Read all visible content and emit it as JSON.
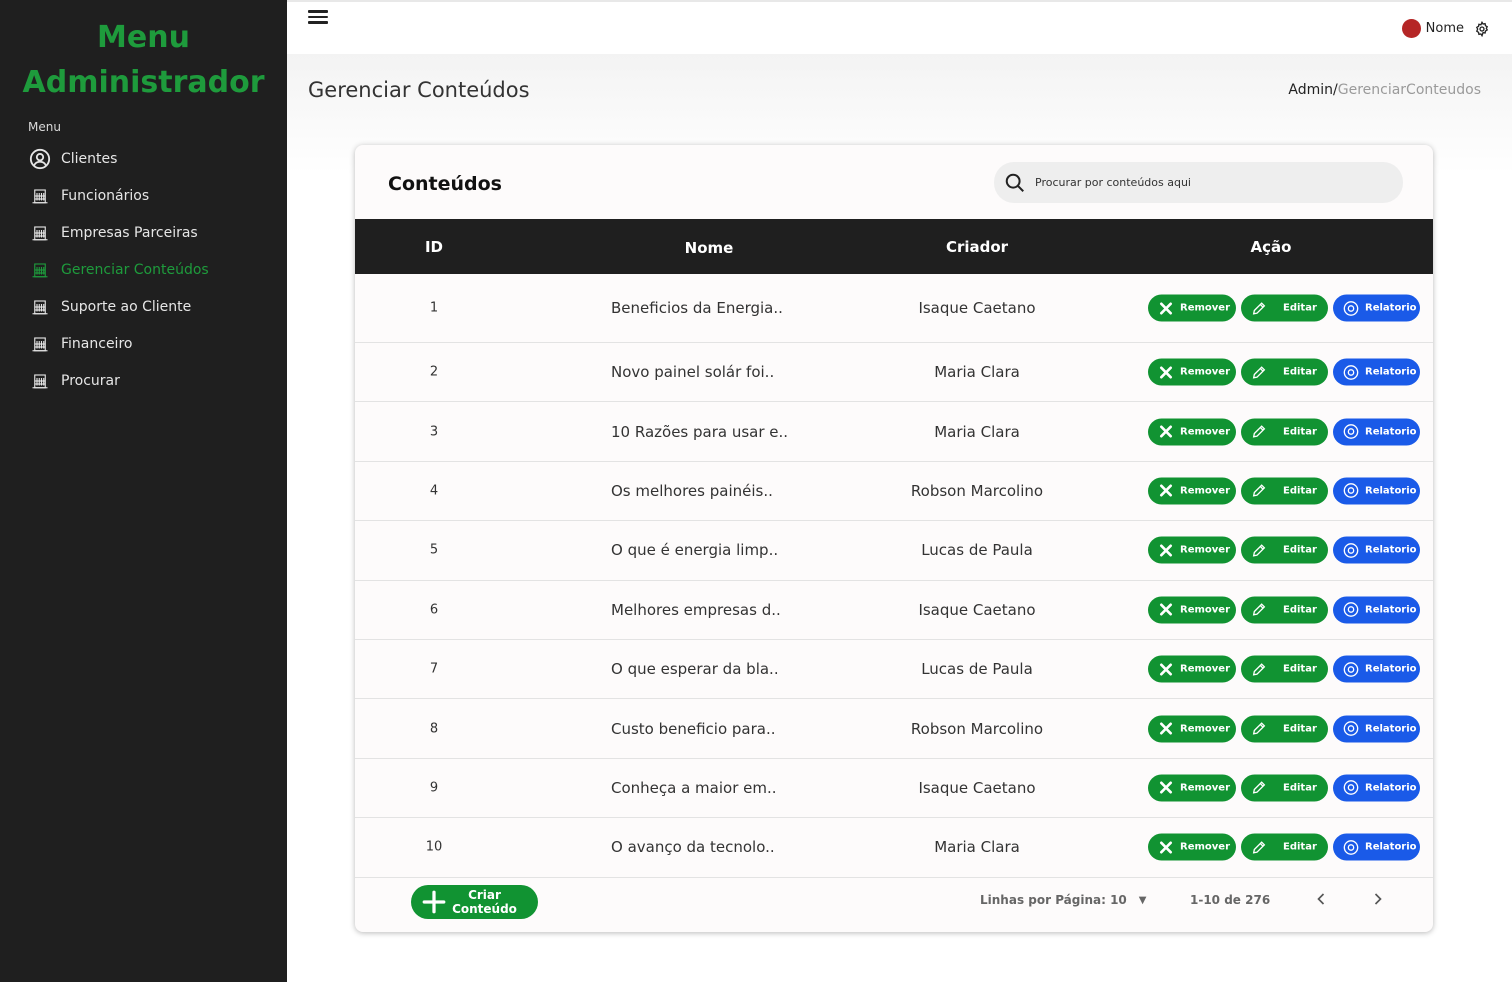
{
  "sidebar": {
    "brand_line1": "Menu",
    "brand_line2": "Administrador",
    "menu_label": "Menu",
    "items": [
      {
        "label": "Clientes",
        "icon": "user-circle-icon"
      },
      {
        "label": "Funcionários",
        "icon": "building-icon"
      },
      {
        "label": "Empresas Parceiras",
        "icon": "building-icon"
      },
      {
        "label": "Gerenciar Conteúdos",
        "icon": "building-icon",
        "active": true
      },
      {
        "label": "Suporte ao Cliente",
        "icon": "building-icon"
      },
      {
        "label": "Financeiro",
        "icon": "building-icon"
      },
      {
        "label": "Procurar",
        "icon": "building-icon"
      }
    ]
  },
  "topbar": {
    "user_name": "Nome"
  },
  "page": {
    "title": "Gerenciar Conteúdos",
    "breadcrumb_root": "Admin",
    "breadcrumb_sep": "/",
    "breadcrumb_current": "GerenciarConteudos"
  },
  "card": {
    "title": "Conteúdos",
    "search_placeholder": "Procurar por conteúdos aqui",
    "columns": {
      "id": "ID",
      "name": "Nome",
      "creator": "Criador",
      "action": "Ação"
    },
    "action_labels": {
      "remove": "Remover",
      "edit": "Editar",
      "report": "Relatorio"
    },
    "rows": [
      {
        "id": "1",
        "name": "Beneficios da Energia..",
        "creator": "Isaque Caetano"
      },
      {
        "id": "2",
        "name": "Novo painel solár foi..",
        "creator": "Maria Clara"
      },
      {
        "id": "3",
        "name": "10 Razões para usar e..",
        "creator": "Maria Clara"
      },
      {
        "id": "4",
        "name": "Os melhores painéis..",
        "creator": "Robson Marcolino"
      },
      {
        "id": "5",
        "name": "O que é energia limp..",
        "creator": "Lucas de Paula"
      },
      {
        "id": "6",
        "name": "Melhores empresas d..",
        "creator": "Isaque Caetano"
      },
      {
        "id": "7",
        "name": "O que esperar da bla..",
        "creator": "Lucas de Paula"
      },
      {
        "id": "8",
        "name": "Custo beneficio para..",
        "creator": "Robson Marcolino"
      },
      {
        "id": "9",
        "name": "Conheça a maior em..",
        "creator": "Isaque Caetano"
      },
      {
        "id": "10",
        "name": "O avanço da tecnolo..",
        "creator": "Maria Clara"
      }
    ],
    "footer": {
      "create_line1": "Criar",
      "create_line2": "Conteúdo",
      "rows_per_page": "Linhas por Página: 10",
      "range": "1-10 de 276"
    }
  },
  "colors": {
    "brand_green": "#1e9b3c",
    "button_green": "#119332",
    "button_blue": "#1a5ae8",
    "sidebar_bg": "#1f1f1f"
  }
}
